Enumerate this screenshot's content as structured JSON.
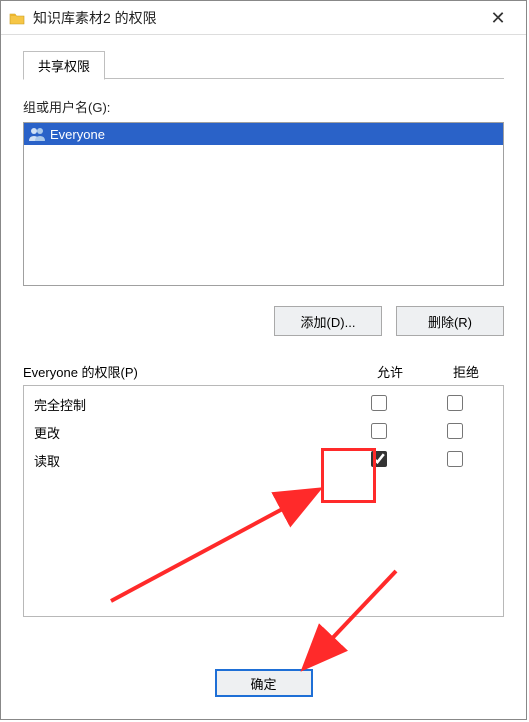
{
  "window": {
    "title": "知识库素材2 的权限"
  },
  "tabs": {
    "share": "共享权限"
  },
  "labels": {
    "group_or_user": "组或用户名(G):",
    "permissions_for": "Everyone 的权限(P)",
    "allow": "允许",
    "deny": "拒绝"
  },
  "users": [
    {
      "name": "Everyone",
      "selected": true
    }
  ],
  "buttons": {
    "add": "添加(D)...",
    "remove": "删除(R)",
    "ok": "确定"
  },
  "permissions": [
    {
      "name": "完全控制",
      "allow": false,
      "deny": false
    },
    {
      "name": "更改",
      "allow": false,
      "deny": false
    },
    {
      "name": "读取",
      "allow": true,
      "deny": false
    }
  ]
}
